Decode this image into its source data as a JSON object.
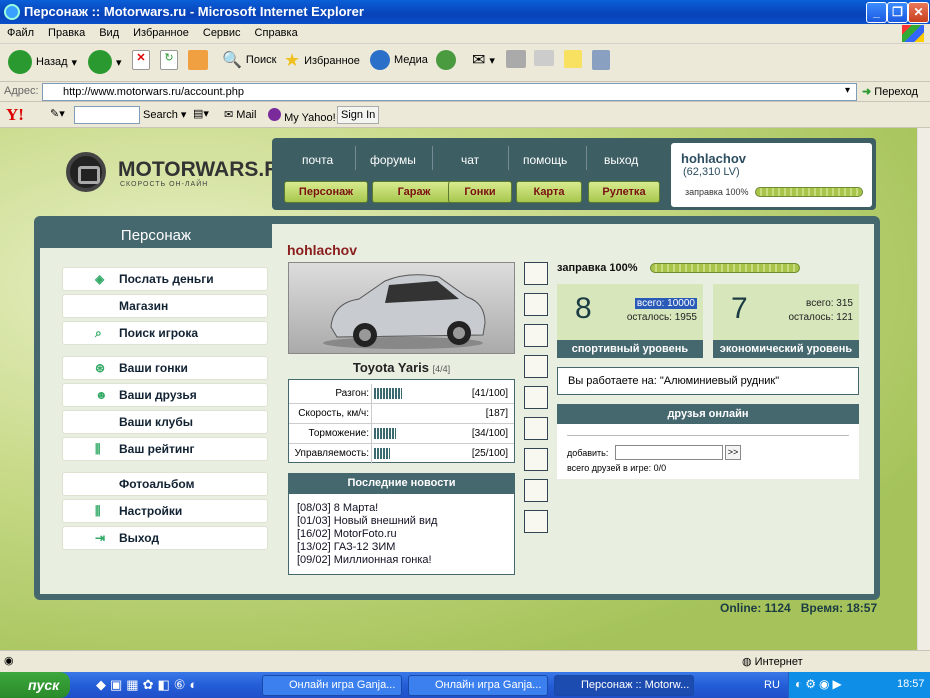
{
  "window": {
    "title": "Персонаж :: Motorwars.ru - Microsoft Internet Explorer"
  },
  "menu": [
    "Файл",
    "Правка",
    "Вид",
    "Избранное",
    "Сервис",
    "Справка"
  ],
  "toolbar": {
    "back": "Назад",
    "search": "Поиск",
    "favorites": "Избранное",
    "media": "Медиа"
  },
  "address": {
    "label": "Адрес:",
    "url": "http://www.motorwars.ru/account.php",
    "go": "Переход"
  },
  "yahoo": {
    "logo": "Y!",
    "search": "Search",
    "mail": "Mail",
    "myyahoo": "My Yahoo!",
    "signin": "Sign In"
  },
  "site": {
    "logo": "MOTORWARS.RU",
    "tagline": "СКОРОСТЬ ОН-ЛАЙН",
    "nav": [
      "почта",
      "форумы",
      "чат",
      "помощь",
      "выход"
    ],
    "nav_buttons": [
      "Персонаж",
      "Гараж",
      "Гонки",
      "Карта",
      "Рулетка"
    ],
    "user": {
      "name": "hohlachov",
      "money": "(62,310 LV)",
      "fuel_label": "заправка 100%",
      "fuel": 1.0
    }
  },
  "panel": {
    "title": "Персонаж",
    "menu": [
      {
        "label": "Послать деньги",
        "icon": "money-icon"
      },
      {
        "label": "Магазин",
        "icon": ""
      },
      {
        "label": "Поиск игрока",
        "icon": "search-icon"
      },
      {
        "label": "Ваши гонки",
        "icon": "steering-wheel-icon"
      },
      {
        "label": "Ваши друзья",
        "icon": "friends-icon"
      },
      {
        "label": "Ваши клубы",
        "icon": ""
      },
      {
        "label": "Ваш рейтинг",
        "icon": "rating-icon"
      },
      {
        "label": "Фотоальбом",
        "icon": ""
      },
      {
        "label": "Настройки",
        "icon": "settings-icon"
      },
      {
        "label": "Выход",
        "icon": "exit-icon"
      }
    ],
    "username": "hohlachov",
    "car": {
      "name": "Toyota Yaris",
      "grade": "[4/4]"
    },
    "stats": [
      {
        "label": "Разгон:",
        "value": "[41/100]"
      },
      {
        "label": "Скорость, км/ч:",
        "value": "[187]"
      },
      {
        "label": "Торможение:",
        "value": "[34/100]"
      },
      {
        "label": "Управляемость:",
        "value": "[25/100]"
      }
    ],
    "news_title": "Последние новости",
    "news": [
      "[08/03] 8 Марта!",
      "[01/03] Новый внешний вид",
      "[16/02] MotorFoto.ru",
      "[13/02] ГАЗ-12 ЗИМ",
      "[09/02] Миллионная гонка!"
    ],
    "fuel_label": "заправка 100%",
    "fuel": 1.0,
    "sport": {
      "level": "8",
      "total": "всего: 10000",
      "left": "осталось: 1955",
      "caption": "спортивный уровень"
    },
    "econ": {
      "level": "7",
      "total": "всего: 315",
      "left": "осталось: 121",
      "caption": "экономический уровень"
    },
    "work": "Вы работаете на: \"Алюминиевый рудник\"",
    "friends_title": "друзья онлайн",
    "add_label": "добавить:",
    "add_btn": ">>",
    "friends_count": "всего друзей в игре: 0/0"
  },
  "footer": {
    "online": "Online: 1124",
    "time": "Время: 18:57"
  },
  "statusbar": {
    "zone": "Интернет"
  },
  "taskbar": {
    "start": "пуск",
    "tasks": [
      "Онлайн игра Ganja...",
      "Онлайн игра Ganja...",
      "Персонаж :: Motorw..."
    ],
    "lang": "RU",
    "clock": "18:57"
  }
}
